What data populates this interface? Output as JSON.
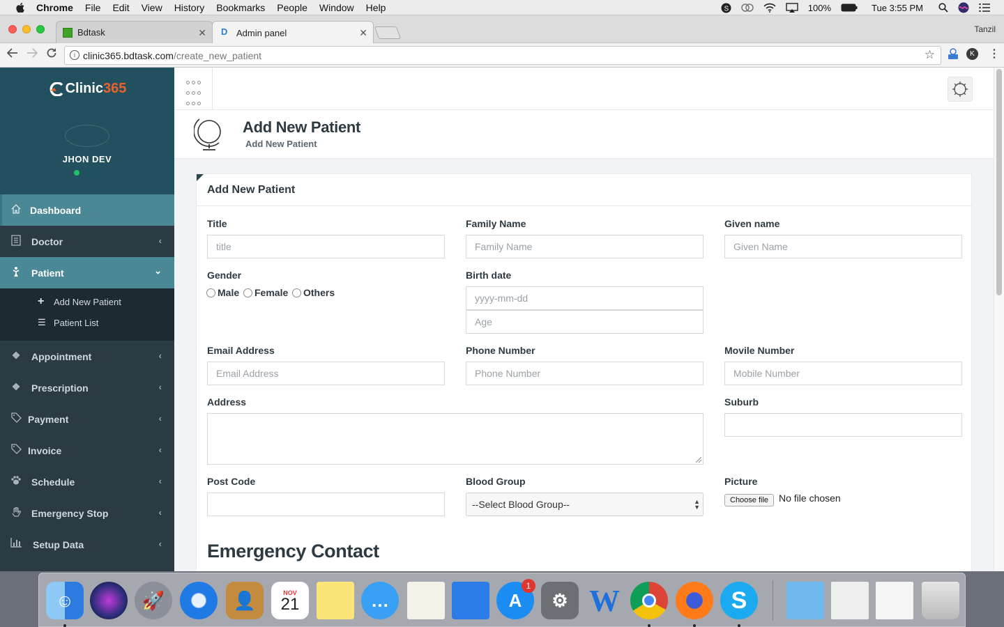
{
  "menubar": {
    "app": "Chrome",
    "items": [
      "File",
      "Edit",
      "View",
      "History",
      "Bookmarks",
      "People",
      "Window",
      "Help"
    ],
    "battery": "100%",
    "clock": "Tue 3:55 PM"
  },
  "browser": {
    "tabs": [
      {
        "title": "Bdtask",
        "favicon": "green-square-icon"
      },
      {
        "title": "Admin panel",
        "favicon": "blue-d-icon"
      }
    ],
    "profile_name": "Tanzil",
    "url_host": "clinic365.bdtask.com",
    "url_path": "/create_new_patient",
    "profile_initial": "K"
  },
  "sidebar": {
    "logo_main": "Clinic",
    "logo_accent": "365",
    "user_name": "JHON DEV",
    "status_color": "#1ec266",
    "items": [
      {
        "label": "Dashboard",
        "icon": "home-icon"
      },
      {
        "label": "Doctor",
        "icon": "document-icon"
      },
      {
        "label": "Patient",
        "icon": "patient-icon"
      },
      {
        "label": "Appointment",
        "icon": "cubes-icon"
      },
      {
        "label": "Prescription",
        "icon": "cubes-icon"
      },
      {
        "label": "Payment",
        "icon": "tag-icon"
      },
      {
        "label": "Invoice",
        "icon": "tag-icon"
      },
      {
        "label": "Schedule",
        "icon": "paw-icon"
      },
      {
        "label": "Emergency Stop",
        "icon": "hand-icon"
      },
      {
        "label": "Setup Data",
        "icon": "bar-chart-icon"
      }
    ],
    "patient_submenu": [
      {
        "label": "Add New Patient",
        "icon": "plus-icon"
      },
      {
        "label": "Patient List",
        "icon": "list-icon"
      }
    ]
  },
  "header": {
    "title": "Add New Patient",
    "subtitle": "Add New Patient"
  },
  "form": {
    "panel_title": "Add New Patient",
    "title_label": "Title",
    "title_placeholder": "title",
    "family_label": "Family Name",
    "family_placeholder": "Family Name",
    "given_label": "Given name",
    "given_placeholder": "Given Name",
    "gender_label": "Gender",
    "gender_options": [
      "Male",
      "Female",
      "Others"
    ],
    "birth_label": "Birth date",
    "birth_placeholder": "yyyy-mm-dd",
    "age_placeholder": "Age",
    "email_label": "Email Address",
    "email_placeholder": "Email Address",
    "phone_label": "Phone Number",
    "phone_placeholder": "Phone Number",
    "mobile_label": "Movile Number",
    "mobile_placeholder": "Mobile Number",
    "address_label": "Address",
    "suburb_label": "Suburb",
    "postcode_label": "Post Code",
    "blood_label": "Blood Group",
    "blood_selected": "--Select Blood Group--",
    "picture_label": "Picture",
    "file_button": "Choose file",
    "file_status": "No file chosen",
    "emergency_heading": "Emergency Contact"
  },
  "dock": {
    "calendar_month": "NOV",
    "calendar_day": "21",
    "appstore_badge": "1"
  }
}
